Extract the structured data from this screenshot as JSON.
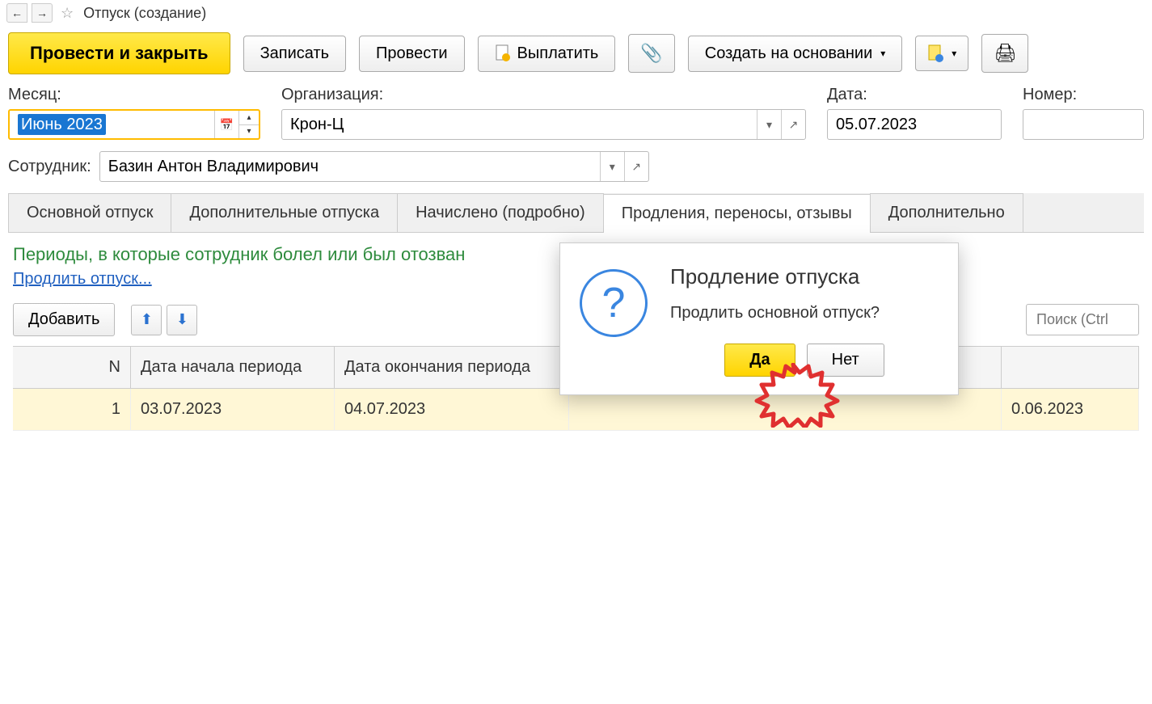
{
  "title": "Отпуск (создание)",
  "toolbar": {
    "post_close": "Провести и закрыть",
    "save": "Записать",
    "post": "Провести",
    "pay": "Выплатить",
    "create_based": "Создать на основании"
  },
  "labels": {
    "month": "Месяц:",
    "org": "Организация:",
    "date": "Дата:",
    "number": "Номер:",
    "employee": "Сотрудник:"
  },
  "values": {
    "month": "Июнь 2023",
    "org": "Крон-Ц",
    "date": "05.07.2023",
    "number": "",
    "employee": "Базин Антон Владимирович"
  },
  "tabs": [
    "Основной отпуск",
    "Дополнительные отпуска",
    "Начислено (подробно)",
    "Продления, переносы, отзывы",
    "Дополнительно"
  ],
  "active_tab": 3,
  "content": {
    "periods_title": "Периоды, в которые сотрудник болел или был отозван",
    "extend_link": "Продлить отпуск...",
    "add_btn": "Добавить",
    "search_placeholder": "Поиск (Ctrl"
  },
  "grid": {
    "headers": [
      "N",
      "Дата начала периода",
      "Дата окончания периода",
      "",
      ""
    ],
    "rows": [
      {
        "n": "1",
        "start": "03.07.2023",
        "end": "04.07.2023",
        "type": "",
        "date2": "0.06.2023"
      }
    ]
  },
  "dialog": {
    "title": "Продление отпуска",
    "message": "Продлить основной отпуск?",
    "yes": "Да",
    "no": "Нет"
  }
}
